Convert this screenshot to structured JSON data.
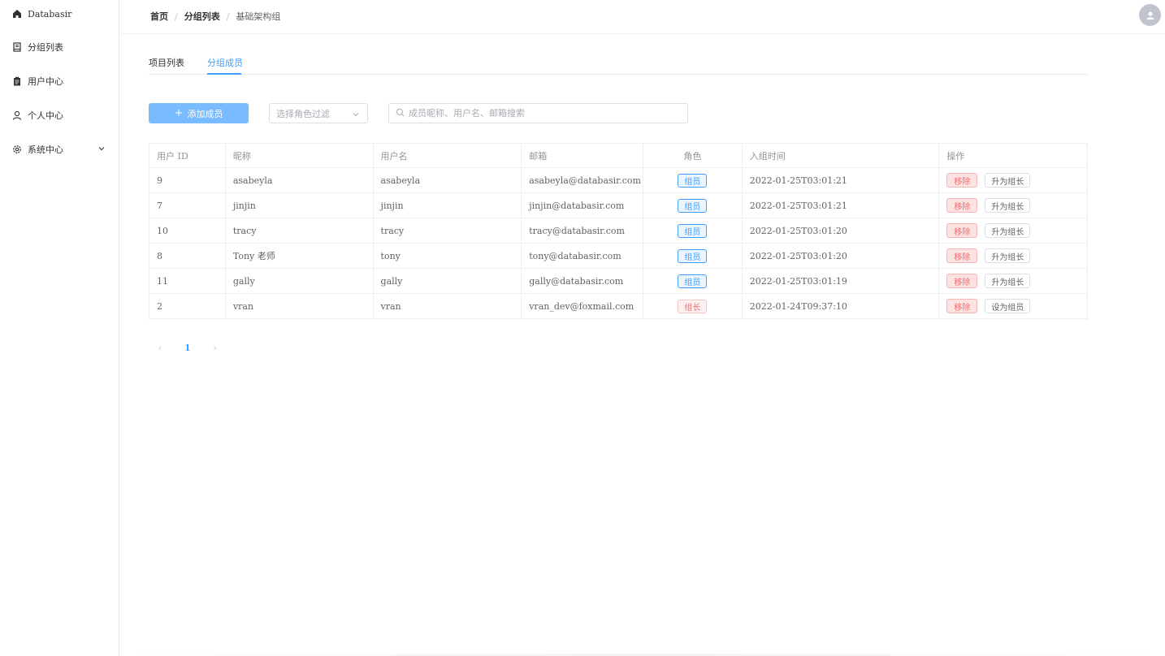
{
  "sidebar": {
    "items": [
      {
        "label": "Databasir",
        "icon": "home-icon"
      },
      {
        "label": "分组列表",
        "icon": "notebook-icon"
      },
      {
        "label": "用户中心",
        "icon": "clipboard-icon"
      },
      {
        "label": "个人中心",
        "icon": "user-icon"
      },
      {
        "label": "系统中心",
        "icon": "gear-icon"
      }
    ]
  },
  "header": {
    "breadcrumb": [
      "首页",
      "分组列表",
      "基础架构组"
    ],
    "separator": "/",
    "avatar_icon": "user-avatar-icon"
  },
  "tabs": [
    {
      "label": "项目列表",
      "active": false
    },
    {
      "label": "分组成员",
      "active": true
    }
  ],
  "toolbar": {
    "add_label": "添加成员",
    "add_icon": "plus",
    "role_filter_placeholder": "选择角色过滤",
    "search_placeholder": "成员昵称、用户名、邮箱搜索"
  },
  "table": {
    "columns": [
      "用户 ID",
      "昵称",
      "用户名",
      "邮箱",
      "角色",
      "入组时间",
      "操作"
    ],
    "rows": [
      {
        "id": "9",
        "nickname": "asabeyla",
        "username": "asabeyla",
        "email": "asabeyla@databasir.com",
        "role": "组员",
        "role_type": "member",
        "joined": "2022-01-25T03:01:21",
        "remove": "移除",
        "action": "升为组长"
      },
      {
        "id": "7",
        "nickname": "jinjin",
        "username": "jinjin",
        "email": "jinjin@databasir.com",
        "role": "组员",
        "role_type": "member",
        "joined": "2022-01-25T03:01:21",
        "remove": "移除",
        "action": "升为组长"
      },
      {
        "id": "10",
        "nickname": "tracy",
        "username": "tracy",
        "email": "tracy@databasir.com",
        "role": "组员",
        "role_type": "member",
        "joined": "2022-01-25T03:01:20",
        "remove": "移除",
        "action": "升为组长"
      },
      {
        "id": "8",
        "nickname": "Tony 老师",
        "username": "tony",
        "email": "tony@databasir.com",
        "role": "组员",
        "role_type": "member",
        "joined": "2022-01-25T03:01:20",
        "remove": "移除",
        "action": "升为组长"
      },
      {
        "id": "11",
        "nickname": "gally",
        "username": "gally",
        "email": "gally@databasir.com",
        "role": "组员",
        "role_type": "member",
        "joined": "2022-01-25T03:01:19",
        "remove": "移除",
        "action": "升为组长"
      },
      {
        "id": "2",
        "nickname": "vran",
        "username": "vran",
        "email": "vran_dev@foxmail.com",
        "role": "组长",
        "role_type": "leader",
        "joined": "2022-01-24T09:37:10",
        "remove": "移除",
        "action": "设为组员"
      }
    ]
  },
  "pagination": {
    "prev": "‹",
    "current_page": "1",
    "next": "›"
  },
  "colors": {
    "primary": "#409eff",
    "primary_light": "#79bbff",
    "danger": "#f56c6c"
  }
}
